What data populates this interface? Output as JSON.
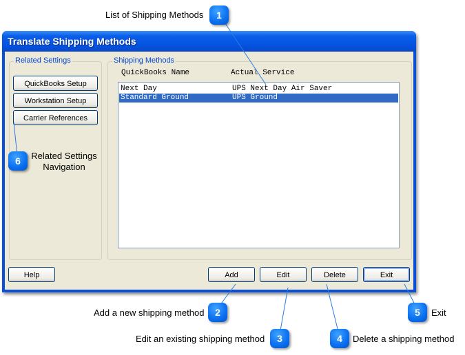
{
  "window": {
    "title": "Translate Shipping Methods"
  },
  "related_settings": {
    "label": "Related Settings",
    "buttons": [
      "QuickBooks Setup",
      "Workstation Setup",
      "Carrier References"
    ]
  },
  "shipping_methods": {
    "label": "Shipping Methods",
    "columns": [
      "QuickBooks Name",
      "Actual Service"
    ],
    "rows": [
      {
        "name": "Next Day",
        "service": "UPS Next Day Air Saver",
        "selected": false
      },
      {
        "name": "Standard Ground",
        "service": "UPS Ground",
        "selected": true
      }
    ]
  },
  "buttons": {
    "help": "Help",
    "add": "Add",
    "edit": "Edit",
    "delete": "Delete",
    "exit": "Exit"
  },
  "annotations": [
    {
      "number": "1",
      "text": "List of Shipping Methods"
    },
    {
      "number": "2",
      "text": "Add a new shipping method"
    },
    {
      "number": "3",
      "text": "Edit an existing shipping method"
    },
    {
      "number": "4",
      "text": "Delete a shipping method"
    },
    {
      "number": "5",
      "text": "Exit"
    },
    {
      "number": "6",
      "text": "Related Settings Navigation"
    }
  ],
  "colors": {
    "accent": "#0a6ff0",
    "selection": "#316ac5",
    "title_bar": "#0553e0"
  }
}
